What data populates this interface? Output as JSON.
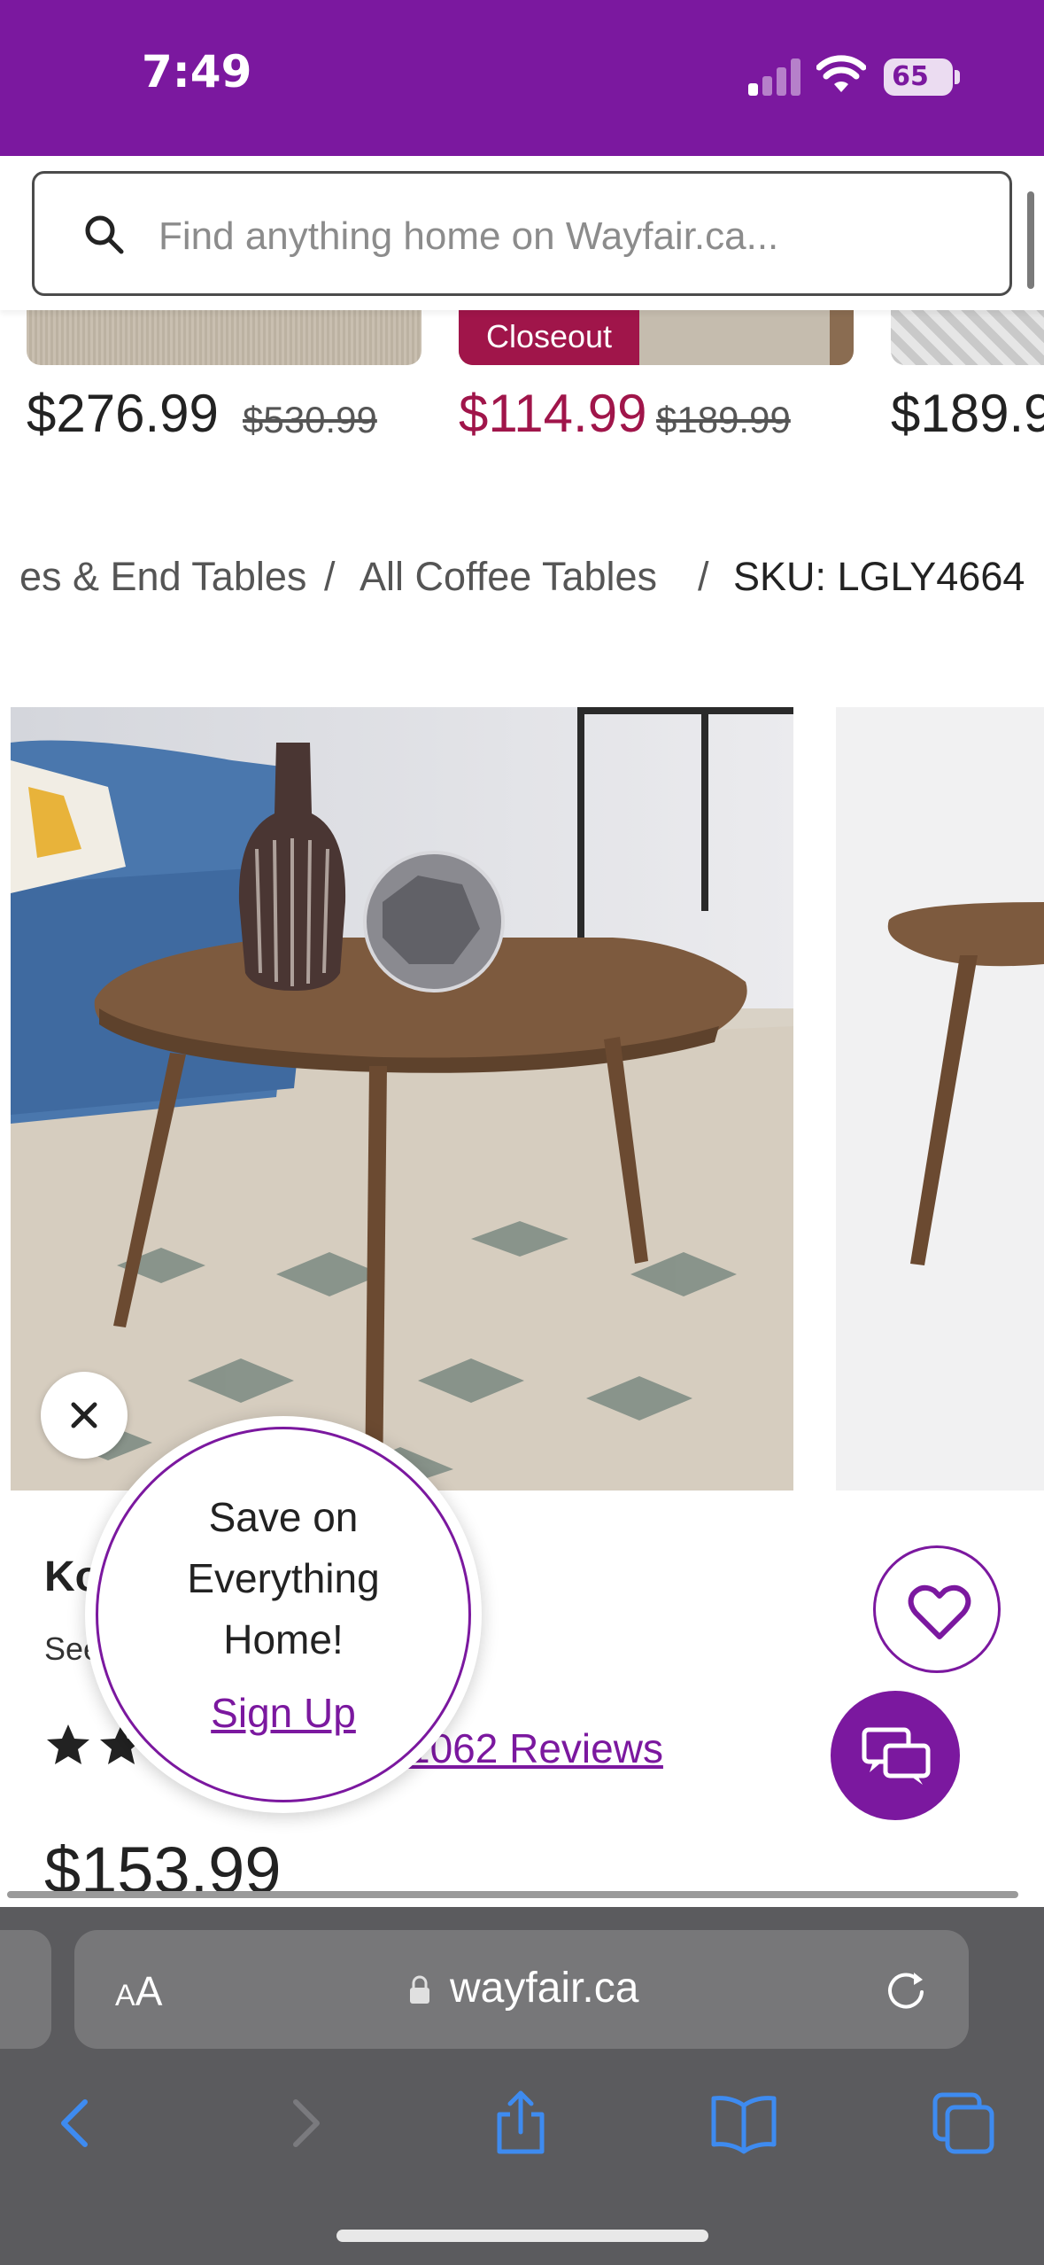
{
  "status_bar": {
    "time": "7:49",
    "battery": "65"
  },
  "search": {
    "placeholder": "Find anything home on Wayfair.ca..."
  },
  "carousel": {
    "items": [
      {
        "price": "$276.99",
        "old_price": "$530.99"
      },
      {
        "badge": "Closeout",
        "price": "$114.99",
        "old_price": "$189.99"
      },
      {
        "price": "$189.9"
      }
    ]
  },
  "breadcrumb": {
    "items": [
      "es & End Tables",
      "All Coffee Tables"
    ],
    "separator": "/",
    "current": "SKU: LGLY4664"
  },
  "product": {
    "title": "Ko",
    "sub": "See",
    "rating_stars": 2,
    "reviews": "1062 Reviews",
    "price": "$153.99"
  },
  "popup": {
    "line1": "Save on",
    "line2": "Everything",
    "line3": "Home!",
    "link": "Sign Up"
  },
  "browser": {
    "aa_small": "A",
    "aa_large": "A",
    "url": "wayfair.ca"
  },
  "colors": {
    "brand": "#7b189f",
    "sale": "#a0154a",
    "chrome": "#5b5b5e",
    "toolbar_icon": "#3e8bf0"
  }
}
